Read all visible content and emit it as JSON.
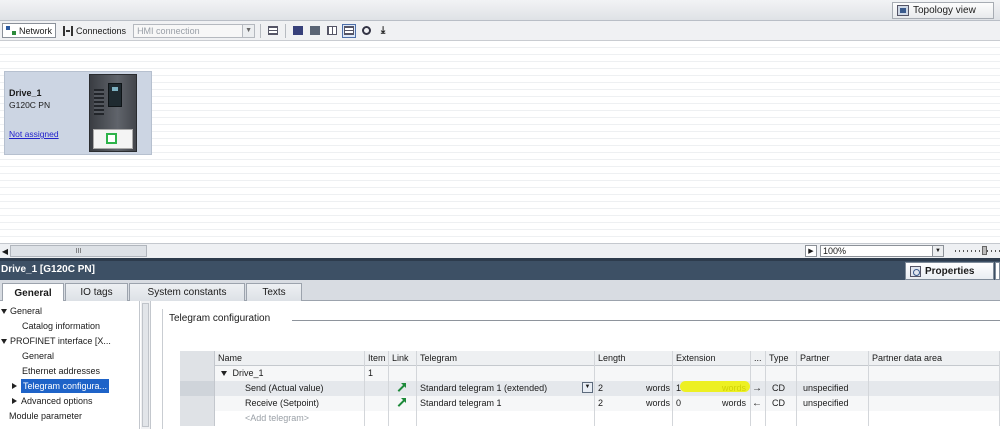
{
  "topbar": {
    "topology_view_label": "Topology view"
  },
  "toolbar": {
    "network_label": "Network",
    "connections_label": "Connections",
    "hmi_connection_value": "HMI connection"
  },
  "device": {
    "name": "Drive_1",
    "type": "G120C PN",
    "assignment_link": "Not assigned"
  },
  "scroll": {
    "thumb_grip": "III",
    "zoom_value": "100%"
  },
  "inspector": {
    "title": "Drive_1 [G120C PN]",
    "properties_tab": "Properties",
    "tabs": [
      "General",
      "IO tags",
      "System constants",
      "Texts"
    ]
  },
  "nav": {
    "items": [
      "General",
      "Catalog information",
      "PROFINET interface [X...",
      "General",
      "Ethernet addresses",
      "Telegram configura...",
      "Advanced options",
      "Module parameter"
    ]
  },
  "section": {
    "title": "Telegram configuration"
  },
  "table": {
    "headers": {
      "name": "Name",
      "item": "Item",
      "link": "Link",
      "telegram": "Telegram",
      "length": "Length",
      "extension": "Extension",
      "dots": "...",
      "type": "Type",
      "partner": "Partner",
      "partner_area": "Partner data area"
    },
    "group": {
      "name": "Drive_1",
      "item": "1"
    },
    "rows": [
      {
        "name": "Send (Actual value)",
        "telegram": "Standard telegram 1 (extended)",
        "length": "2",
        "length_unit": "words",
        "extension": "1",
        "extension_unit": "words",
        "direction": "→",
        "type": "CD",
        "partner": "unspecified"
      },
      {
        "name": "Receive (Setpoint)",
        "telegram": "Standard telegram 1",
        "length": "2",
        "length_unit": "words",
        "extension": "0",
        "extension_unit": "words",
        "direction": "←",
        "type": "CD",
        "partner": "unspecified"
      }
    ],
    "add_label": "<Add telegram>"
  }
}
